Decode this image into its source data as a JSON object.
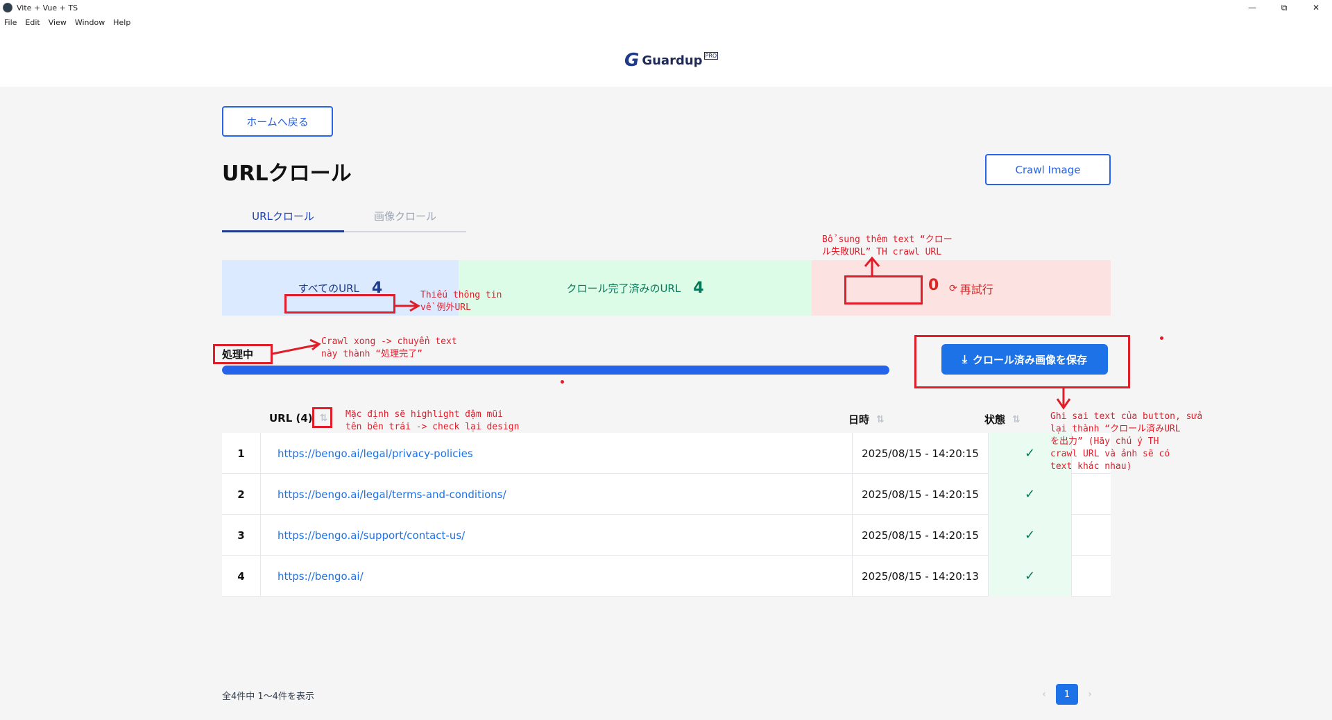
{
  "window": {
    "title": "Vite + Vue + TS",
    "controls": {
      "minimize": "—",
      "maximize": "⧉",
      "close": "✕"
    }
  },
  "menu": [
    "File",
    "Edit",
    "View",
    "Window",
    "Help"
  ],
  "logo": {
    "mark": "G",
    "text": "Guardup",
    "badge": "PRO"
  },
  "nav": {
    "home_button": "ホームへ戻る"
  },
  "page": {
    "title": "URLクロール",
    "crawl_image_button": "Crawl Image",
    "tabs": [
      {
        "label": "URLクロール",
        "active": true
      },
      {
        "label": "画像クロール",
        "active": false
      }
    ]
  },
  "stats": {
    "all": {
      "label": "すべてのURL",
      "value": "4"
    },
    "done": {
      "label": "クロール完了済みのURL",
      "value": "4"
    },
    "failed": {
      "label": "",
      "value": "0",
      "retry_label": "再試行"
    }
  },
  "processing": {
    "label": "処理中",
    "progress_percent": 100
  },
  "save_button": "クロール済み画像を保存",
  "table": {
    "headers": {
      "url": "URL (4)",
      "datetime": "日時",
      "status": "状態"
    },
    "rows": [
      {
        "index": "1",
        "url": "https://bengo.ai/legal/privacy-policies",
        "datetime": "2025/08/15 - 14:20:15",
        "status": "✓"
      },
      {
        "index": "2",
        "url": "https://bengo.ai/legal/terms-and-conditions/",
        "datetime": "2025/08/15 - 14:20:15",
        "status": "✓"
      },
      {
        "index": "3",
        "url": "https://bengo.ai/support/contact-us/",
        "datetime": "2025/08/15 - 14:20:15",
        "status": "✓"
      },
      {
        "index": "4",
        "url": "https://bengo.ai/",
        "datetime": "2025/08/15 - 14:20:13",
        "status": "✓"
      }
    ]
  },
  "footer": {
    "summary": "全4件中 1〜4件を表示",
    "pagination": {
      "prev": "‹",
      "current": "1",
      "next": "›"
    }
  },
  "annotations": {
    "fail_label_note": "Bổ sung thêm text “クロー\nル失敗URL” TH crawl URL",
    "all_url_note": "Thiếu thông tin\nvề 例外URL",
    "status_note": "Crawl xong -> chuyển text\nnày thành “処理完了”",
    "sort_note": "Mặc định sẽ highlight đậm mũi\ntên bên trái -> check lại design",
    "save_note": "Ghi sai text của button, sửa\nlại thành “クロール済みURL\nを出力” (Hãy chú ý TH\ncrawl URL và ảnh sẽ có\ntext khác nhau)"
  },
  "colors": {
    "accent": "#2563eb",
    "annotation": "#e11d2a",
    "success": "#047857",
    "danger": "#dc2626"
  }
}
